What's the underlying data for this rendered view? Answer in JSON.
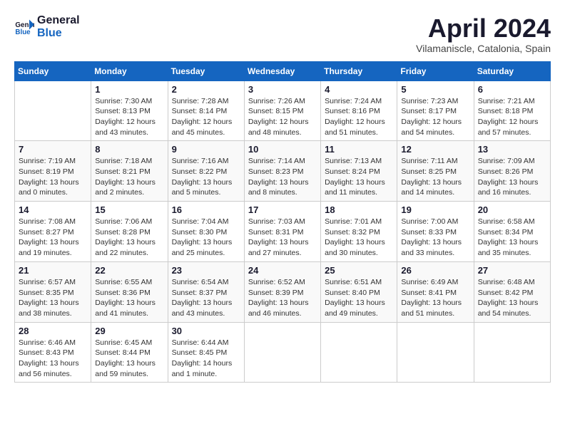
{
  "header": {
    "logo_line1": "General",
    "logo_line2": "Blue",
    "month_title": "April 2024",
    "subtitle": "Vilamaniscle, Catalonia, Spain"
  },
  "days_of_week": [
    "Sunday",
    "Monday",
    "Tuesday",
    "Wednesday",
    "Thursday",
    "Friday",
    "Saturday"
  ],
  "weeks": [
    [
      {
        "day": "",
        "info": ""
      },
      {
        "day": "1",
        "info": "Sunrise: 7:30 AM\nSunset: 8:13 PM\nDaylight: 12 hours\nand 43 minutes."
      },
      {
        "day": "2",
        "info": "Sunrise: 7:28 AM\nSunset: 8:14 PM\nDaylight: 12 hours\nand 45 minutes."
      },
      {
        "day": "3",
        "info": "Sunrise: 7:26 AM\nSunset: 8:15 PM\nDaylight: 12 hours\nand 48 minutes."
      },
      {
        "day": "4",
        "info": "Sunrise: 7:24 AM\nSunset: 8:16 PM\nDaylight: 12 hours\nand 51 minutes."
      },
      {
        "day": "5",
        "info": "Sunrise: 7:23 AM\nSunset: 8:17 PM\nDaylight: 12 hours\nand 54 minutes."
      },
      {
        "day": "6",
        "info": "Sunrise: 7:21 AM\nSunset: 8:18 PM\nDaylight: 12 hours\nand 57 minutes."
      }
    ],
    [
      {
        "day": "7",
        "info": "Sunrise: 7:19 AM\nSunset: 8:19 PM\nDaylight: 13 hours\nand 0 minutes."
      },
      {
        "day": "8",
        "info": "Sunrise: 7:18 AM\nSunset: 8:21 PM\nDaylight: 13 hours\nand 2 minutes."
      },
      {
        "day": "9",
        "info": "Sunrise: 7:16 AM\nSunset: 8:22 PM\nDaylight: 13 hours\nand 5 minutes."
      },
      {
        "day": "10",
        "info": "Sunrise: 7:14 AM\nSunset: 8:23 PM\nDaylight: 13 hours\nand 8 minutes."
      },
      {
        "day": "11",
        "info": "Sunrise: 7:13 AM\nSunset: 8:24 PM\nDaylight: 13 hours\nand 11 minutes."
      },
      {
        "day": "12",
        "info": "Sunrise: 7:11 AM\nSunset: 8:25 PM\nDaylight: 13 hours\nand 14 minutes."
      },
      {
        "day": "13",
        "info": "Sunrise: 7:09 AM\nSunset: 8:26 PM\nDaylight: 13 hours\nand 16 minutes."
      }
    ],
    [
      {
        "day": "14",
        "info": "Sunrise: 7:08 AM\nSunset: 8:27 PM\nDaylight: 13 hours\nand 19 minutes."
      },
      {
        "day": "15",
        "info": "Sunrise: 7:06 AM\nSunset: 8:28 PM\nDaylight: 13 hours\nand 22 minutes."
      },
      {
        "day": "16",
        "info": "Sunrise: 7:04 AM\nSunset: 8:30 PM\nDaylight: 13 hours\nand 25 minutes."
      },
      {
        "day": "17",
        "info": "Sunrise: 7:03 AM\nSunset: 8:31 PM\nDaylight: 13 hours\nand 27 minutes."
      },
      {
        "day": "18",
        "info": "Sunrise: 7:01 AM\nSunset: 8:32 PM\nDaylight: 13 hours\nand 30 minutes."
      },
      {
        "day": "19",
        "info": "Sunrise: 7:00 AM\nSunset: 8:33 PM\nDaylight: 13 hours\nand 33 minutes."
      },
      {
        "day": "20",
        "info": "Sunrise: 6:58 AM\nSunset: 8:34 PM\nDaylight: 13 hours\nand 35 minutes."
      }
    ],
    [
      {
        "day": "21",
        "info": "Sunrise: 6:57 AM\nSunset: 8:35 PM\nDaylight: 13 hours\nand 38 minutes."
      },
      {
        "day": "22",
        "info": "Sunrise: 6:55 AM\nSunset: 8:36 PM\nDaylight: 13 hours\nand 41 minutes."
      },
      {
        "day": "23",
        "info": "Sunrise: 6:54 AM\nSunset: 8:37 PM\nDaylight: 13 hours\nand 43 minutes."
      },
      {
        "day": "24",
        "info": "Sunrise: 6:52 AM\nSunset: 8:39 PM\nDaylight: 13 hours\nand 46 minutes."
      },
      {
        "day": "25",
        "info": "Sunrise: 6:51 AM\nSunset: 8:40 PM\nDaylight: 13 hours\nand 49 minutes."
      },
      {
        "day": "26",
        "info": "Sunrise: 6:49 AM\nSunset: 8:41 PM\nDaylight: 13 hours\nand 51 minutes."
      },
      {
        "day": "27",
        "info": "Sunrise: 6:48 AM\nSunset: 8:42 PM\nDaylight: 13 hours\nand 54 minutes."
      }
    ],
    [
      {
        "day": "28",
        "info": "Sunrise: 6:46 AM\nSunset: 8:43 PM\nDaylight: 13 hours\nand 56 minutes."
      },
      {
        "day": "29",
        "info": "Sunrise: 6:45 AM\nSunset: 8:44 PM\nDaylight: 13 hours\nand 59 minutes."
      },
      {
        "day": "30",
        "info": "Sunrise: 6:44 AM\nSunset: 8:45 PM\nDaylight: 14 hours\nand 1 minute."
      },
      {
        "day": "",
        "info": ""
      },
      {
        "day": "",
        "info": ""
      },
      {
        "day": "",
        "info": ""
      },
      {
        "day": "",
        "info": ""
      }
    ]
  ]
}
